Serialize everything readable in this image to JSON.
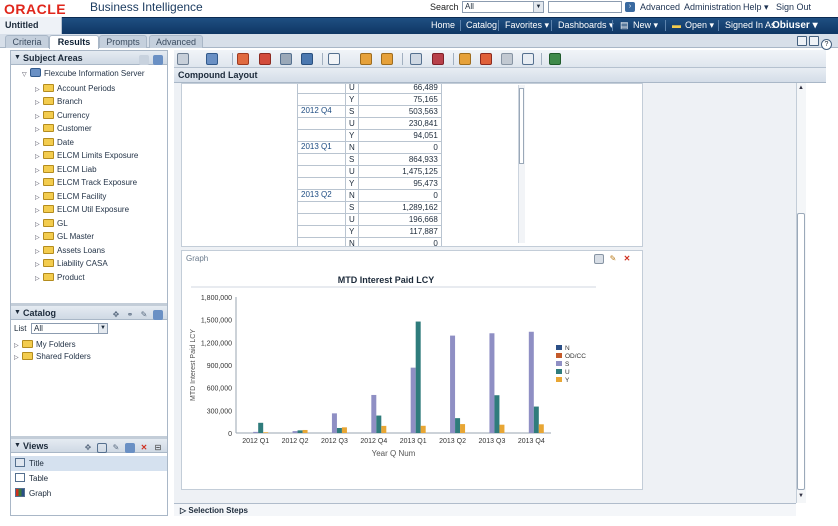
{
  "header": {
    "logo": "ORACLE",
    "product": "Business Intelligence",
    "search_label": "Search",
    "search_scope": "All",
    "links": [
      "Advanced",
      "Administration",
      "Help ▾",
      "Sign Out"
    ]
  },
  "navbar": {
    "doc_title": "Untitled",
    "items": [
      "Home",
      "Catalog",
      "Favorites ▾",
      "Dashboards ▾",
      "New ▾",
      "Open ▾",
      "Signed In As"
    ],
    "user": "Obiuser ▾"
  },
  "tabs": [
    "Criteria",
    "Results",
    "Prompts",
    "Advanced"
  ],
  "active_tab": "Results",
  "subject_areas": {
    "title": "Subject Areas",
    "root": "Flexcube Information Server",
    "folders": [
      "Account Periods",
      "Branch",
      "Currency",
      "Customer",
      "Date",
      "ELCM Limits Exposure",
      "ELCM Liab",
      "ELCM Track Exposure",
      "ELCM Facility",
      "ELCM Util Exposure",
      "GL",
      "GL Master",
      "Assets Loans",
      "Liability CASA",
      "Product"
    ]
  },
  "catalog": {
    "title": "Catalog",
    "list_label": "List",
    "list_value": "All",
    "folders": [
      "My Folders",
      "Shared Folders"
    ]
  },
  "views": {
    "title": "Views",
    "items": [
      "Title",
      "Table",
      "Graph"
    ],
    "selected": "Title"
  },
  "layout": {
    "title": "Compound Layout",
    "selection_steps": "Selection Steps"
  },
  "pivot_table": {
    "rows": [
      {
        "q": "",
        "v": "U",
        "n": "66,489"
      },
      {
        "q": "",
        "v": "Y",
        "n": "75,165"
      },
      {
        "q": "2012 Q4",
        "v": "S",
        "n": "503,563"
      },
      {
        "q": "",
        "v": "U",
        "n": "230,841"
      },
      {
        "q": "",
        "v": "Y",
        "n": "94,051"
      },
      {
        "q": "2013 Q1",
        "v": "N",
        "n": "0"
      },
      {
        "q": "",
        "v": "S",
        "n": "864,933"
      },
      {
        "q": "",
        "v": "U",
        "n": "1,475,125"
      },
      {
        "q": "",
        "v": "Y",
        "n": "95,473"
      },
      {
        "q": "2013 Q2",
        "v": "N",
        "n": "0"
      },
      {
        "q": "",
        "v": "S",
        "n": "1,289,162"
      },
      {
        "q": "",
        "v": "U",
        "n": "196,668"
      },
      {
        "q": "",
        "v": "Y",
        "n": "117,887"
      },
      {
        "q": "",
        "v": "N",
        "n": "0"
      }
    ]
  },
  "graph": {
    "panel_label": "Graph"
  },
  "colors": {
    "N": "#2b4f86",
    "OD/CC": "#c45a2a",
    "S": "#8f8fc4",
    "U": "#2f7c7c",
    "Y": "#e8a634"
  },
  "chart_data": {
    "type": "bar",
    "title": "MTD Interest Paid LCY",
    "xlabel": "Year Q Num",
    "ylabel": "MTD Interest Paid LCY",
    "ylim": [
      0,
      1800000
    ],
    "yticks": [
      "0",
      "300,000",
      "600,000",
      "900,000",
      "1,200,000",
      "1,500,000",
      "1,800,000"
    ],
    "categories": [
      "2012 Q1",
      "2012 Q2",
      "2012 Q3",
      "2012 Q4",
      "2013 Q1",
      "2013 Q2",
      "2013 Q3",
      "2013 Q4"
    ],
    "series": [
      {
        "name": "N",
        "values": [
          0,
          0,
          0,
          0,
          0,
          0,
          0,
          0
        ]
      },
      {
        "name": "OD/CC",
        "values": [
          0,
          0,
          0,
          0,
          0,
          0,
          0,
          0
        ]
      },
      {
        "name": "S",
        "values": [
          15000,
          25000,
          260000,
          503563,
          864933,
          1289162,
          1320000,
          1340000
        ]
      },
      {
        "name": "U",
        "values": [
          135000,
          35000,
          66489,
          230841,
          1475125,
          196668,
          500000,
          350000
        ]
      },
      {
        "name": "Y",
        "values": [
          10000,
          40000,
          75165,
          94051,
          95473,
          117887,
          110000,
          115000
        ]
      }
    ],
    "legend": "right",
    "grid": false
  }
}
